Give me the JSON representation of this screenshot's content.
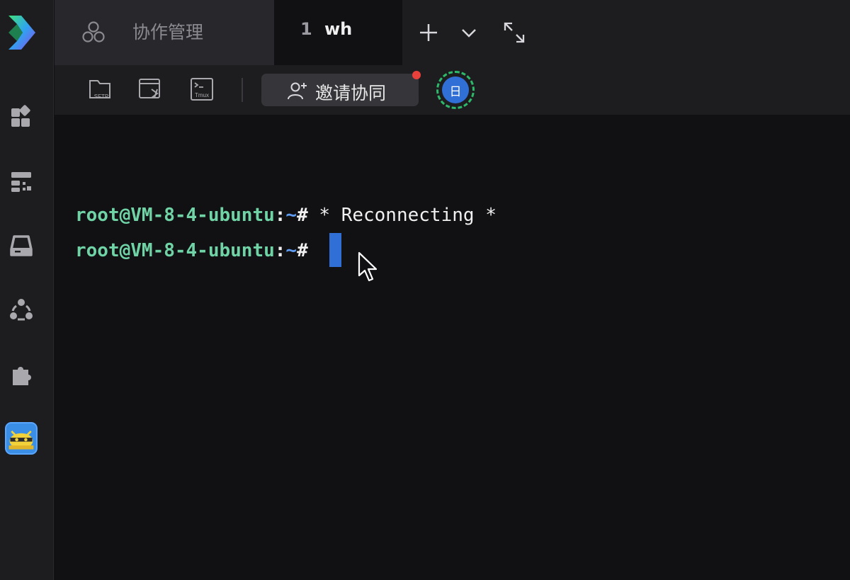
{
  "tabs": {
    "collab": {
      "label": "协作管理",
      "icon": "collab-hexagon-icon"
    },
    "active": {
      "index": "1",
      "name": "wh"
    }
  },
  "toolbar": {
    "sftp_label": "SFTP",
    "tmux_label": "Tmux",
    "invite_label": "邀请协同",
    "user_initial": "日"
  },
  "terminal": {
    "lines": [
      {
        "user": "root@VM-8-4-ubuntu",
        "colon": ":",
        "path": "~",
        "hash": "#",
        "output": " * Reconnecting *"
      },
      {
        "user": "root@VM-8-4-ubuntu",
        "colon": ":",
        "path": "~",
        "hash": "#",
        "output": " "
      }
    ]
  },
  "colors": {
    "prompt_user": "#6fd3a6",
    "prompt_path": "#5f9cf2",
    "cursor": "#2f6fd6",
    "notification_dot": "#e8413b",
    "avatar_ring": "#2db86a"
  }
}
